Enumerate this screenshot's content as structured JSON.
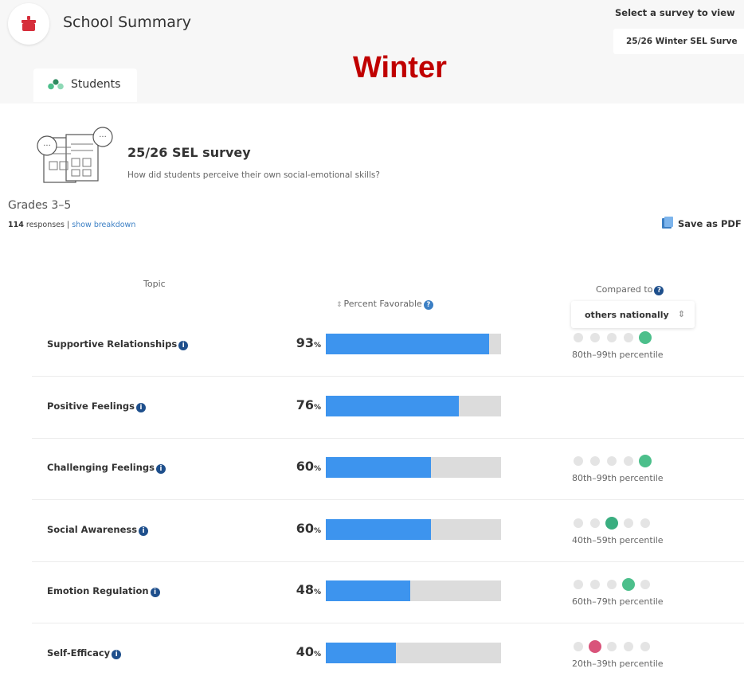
{
  "header": {
    "app_title": "School Summary",
    "survey_select_label": "Select a survey to view",
    "survey_select_value": "25/26 Winter SEL Surve",
    "season_label": "Winter"
  },
  "tabs": [
    {
      "label": "Students",
      "icon": "students-icon"
    }
  ],
  "survey": {
    "title": "25/26 SEL survey",
    "question": "How did students perceive their own social-emotional skills?",
    "grades": "Grades 3–5",
    "responses_count": "114",
    "responses_label": "responses",
    "separator": "|",
    "breakdown_link": "show breakdown",
    "save_pdf": "Save as PDF"
  },
  "table": {
    "col_topic": "Topic",
    "col_percent": "Percent Favorable",
    "col_compared": "Compared to",
    "compare_value": "others nationally",
    "rows": [
      {
        "topic": "Supportive Relationships",
        "percent": "93",
        "unit": "%",
        "percent_value": 93,
        "position": 5,
        "percentile": "80th–99th percentile",
        "dot_color": "#4cbf8b"
      },
      {
        "topic": "Positive Feelings",
        "percent": "76",
        "unit": "%",
        "percent_value": 76,
        "position": 0,
        "percentile": "",
        "dot_color": ""
      },
      {
        "topic": "Challenging Feelings",
        "percent": "60",
        "unit": "%",
        "percent_value": 60,
        "position": 5,
        "percentile": "80th–99th percentile",
        "dot_color": "#4cbf8b"
      },
      {
        "topic": "Social Awareness",
        "percent": "60",
        "unit": "%",
        "percent_value": 60,
        "position": 3,
        "percentile": "40th–59th percentile",
        "dot_color": "#3aae80"
      },
      {
        "topic": "Emotion Regulation",
        "percent": "48",
        "unit": "%",
        "percent_value": 48,
        "position": 4,
        "percentile": "60th–79th percentile",
        "dot_color": "#4cbf8b"
      },
      {
        "topic": "Self-Efficacy",
        "percent": "40",
        "unit": "%",
        "percent_value": 40,
        "position": 2,
        "percentile": "20th–39th percentile",
        "dot_color": "#d9537a"
      }
    ]
  },
  "colors": {
    "bar_fill": "#3d94ee",
    "bar_track": "#dcdcdc",
    "season_label": "#c00000",
    "info_icon": "#1e4f8c"
  }
}
